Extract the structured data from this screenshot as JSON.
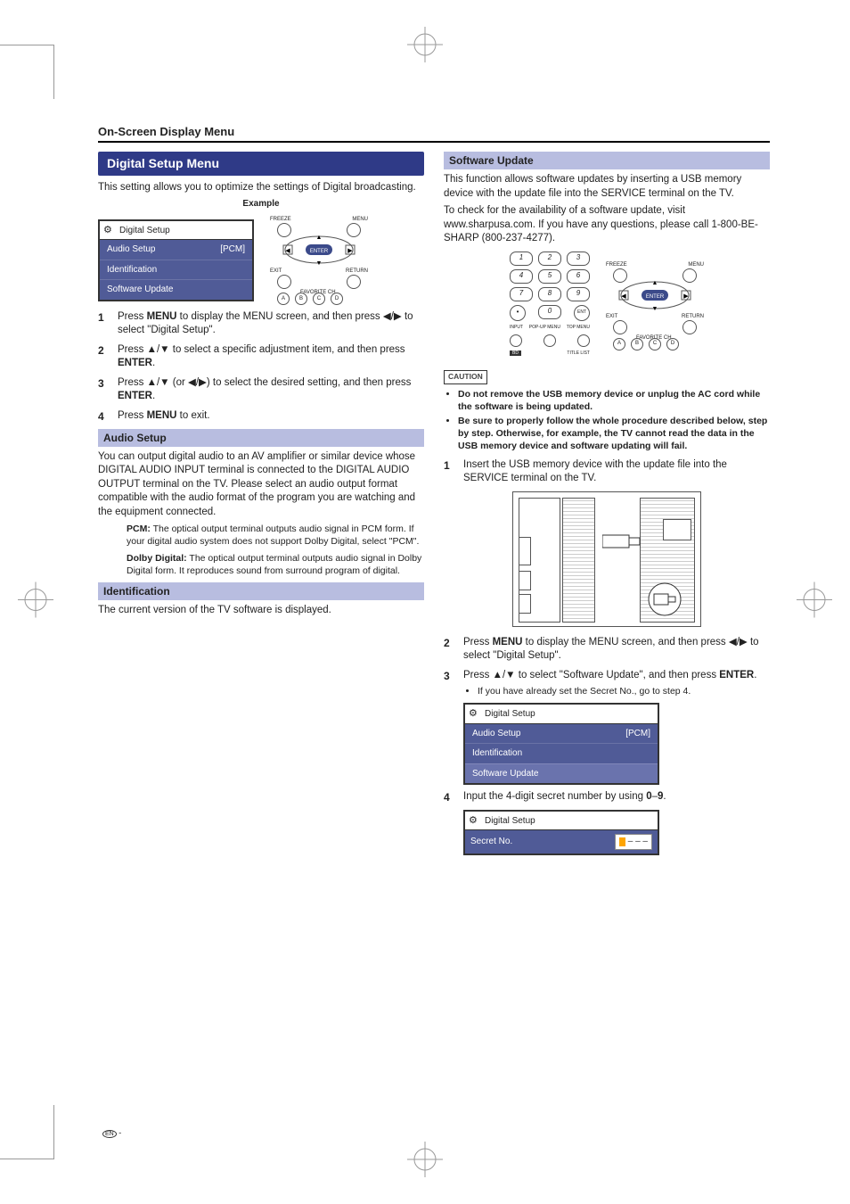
{
  "header": {
    "title": "On-Screen Display Menu"
  },
  "footer": {
    "en": "EN -"
  },
  "left": {
    "title": "Digital Setup Menu",
    "intro": "This setting allows you to optimize the settings of Digital broadcasting.",
    "example_label": "Example",
    "menu": {
      "title": "Digital Setup",
      "rows": [
        {
          "label": "Audio Setup",
          "value": "[PCM]"
        },
        {
          "label": "Identification",
          "value": ""
        },
        {
          "label": "Software Update",
          "value": ""
        }
      ]
    },
    "remote_labels": {
      "freeze": "FREEZE",
      "menu": "MENU",
      "enter": "ENTER",
      "exit": "EXIT",
      "return": "RETURN",
      "fav": "FAVORITE CH",
      "a": "A",
      "b": "B",
      "c": "C",
      "d": "D"
    },
    "steps": [
      {
        "pre": "Press ",
        "b1": "MENU",
        "post": " to display the MENU screen, and then press ◀/▶ to select \"Digital Setup\"."
      },
      {
        "pre": "Press ▲/▼ to select a specific adjustment item, and then press ",
        "b1": "ENTER",
        "post": "."
      },
      {
        "pre": "Press ▲/▼ (or ◀/▶) to select the desired setting, and then press ",
        "b1": "ENTER",
        "post": "."
      },
      {
        "pre": "Press ",
        "b1": "MENU",
        "post": " to exit."
      }
    ],
    "audio": {
      "title": "Audio Setup",
      "body": "You can output digital audio to an AV amplifier or similar device whose DIGITAL AUDIO INPUT terminal is connected to the DIGITAL AUDIO OUTPUT terminal on the TV. Please select an audio output format compatible with the audio format of the program you are watching and the equipment connected.",
      "pcm_label": "PCM:",
      "pcm_body": " The optical output terminal outputs audio signal in PCM form. If your digital audio system does not support Dolby Digital, select \"PCM\".",
      "dd_label": "Dolby Digital:",
      "dd_body": " The optical output terminal outputs audio signal in Dolby Digital form. It reproduces sound from surround program of digital."
    },
    "ident": {
      "title": "Identification",
      "body": "The current version of the TV software is displayed."
    }
  },
  "right": {
    "title": "Software Update",
    "p1": "This function allows software updates by inserting a USB memory device with the update file into the SERVICE terminal on the TV.",
    "p2": "To check for the availability of a software update, visit www.sharpusa.com. If you have any questions, please call 1-800-BE-SHARP (800-237-4277).",
    "numpad": [
      "1",
      "2",
      "3",
      "4",
      "5",
      "6",
      "7",
      "8",
      "9",
      "•",
      "0",
      "ENT"
    ],
    "numpad_bottom": {
      "input": "INPUT",
      "pop": "POP-UP MENU",
      "top": "TOP MENU",
      "bd": "BD",
      "title": "TITLE LIST"
    },
    "caution_label": "CAUTION",
    "caution_items": [
      "Do not remove the USB memory device or unplug the AC cord while the software is being updated.",
      "Be sure to properly follow the whole procedure described below, step by step. Otherwise, for example, the TV cannot read the data in the USB memory device and software updating will fail."
    ],
    "step1": "Insert the USB memory device with the update file into the SERVICE terminal on the TV.",
    "step2_pre": "Press ",
    "step2_b": "MENU",
    "step2_post": " to display the MENU screen, and then press ◀/▶ to select \"Digital Setup\".",
    "step3_pre": "Press ▲/▼ to select \"Software Update\", and then press ",
    "step3_b": "ENTER",
    "step3_post": ".",
    "step3_sub": "If you have already set the Secret No., go to step 4.",
    "menu2": {
      "title": "Digital Setup",
      "rows": [
        {
          "label": "Audio Setup",
          "value": "[PCM]"
        },
        {
          "label": "Identification",
          "value": ""
        },
        {
          "label": "Software Update",
          "value": ""
        }
      ]
    },
    "step4_pre": "Input the 4-digit secret number by using ",
    "step4_b1": "0",
    "step4_mid": "–",
    "step4_b2": "9",
    "step4_post": ".",
    "secret": {
      "title": "Digital Setup",
      "label": "Secret No.",
      "placeholder": "– – –"
    }
  }
}
